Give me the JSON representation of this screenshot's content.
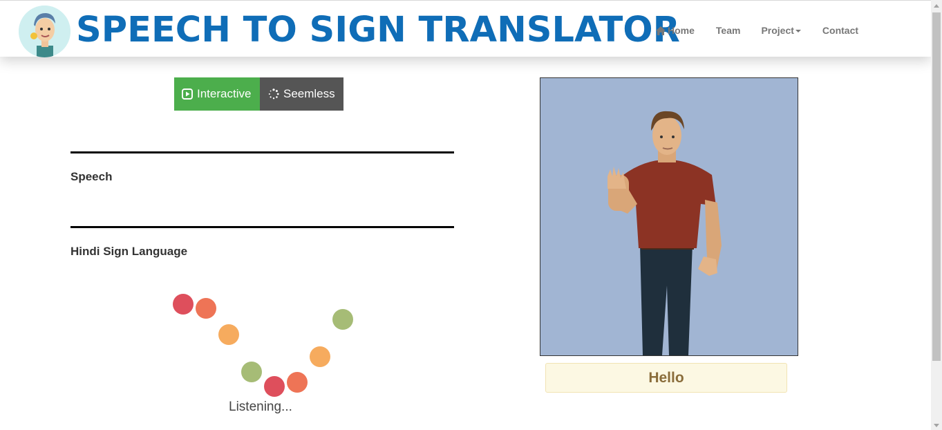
{
  "header": {
    "brand_title": "SPEECH TO SIGN TRANSLATOR",
    "nav": [
      {
        "label": "Home",
        "icon": "home-icon"
      },
      {
        "label": "Team"
      },
      {
        "label": "Project",
        "icon": "caret-down-icon"
      },
      {
        "label": "Contact"
      }
    ]
  },
  "mode_toggle": {
    "interactive_label": "Interactive",
    "seemless_label": "Seemless",
    "active": "Interactive"
  },
  "sections": {
    "speech_label": "Speech",
    "sign_language_label": "Hindi Sign Language"
  },
  "status": {
    "listening_text": "Listening..."
  },
  "avatar": {
    "caption": "Hello"
  },
  "colors": {
    "brand": "#0f6db7",
    "interactive_active": "#4cae4c",
    "seemless_bg": "#555555",
    "avatar_bg": "#a1b5d3",
    "caption_bg": "#fcf8e3",
    "caption_text": "#8a6d3b",
    "loader_dots": [
      "#de4f5c",
      "#ee7456",
      "#f6ab5e",
      "#a6bc76"
    ]
  }
}
